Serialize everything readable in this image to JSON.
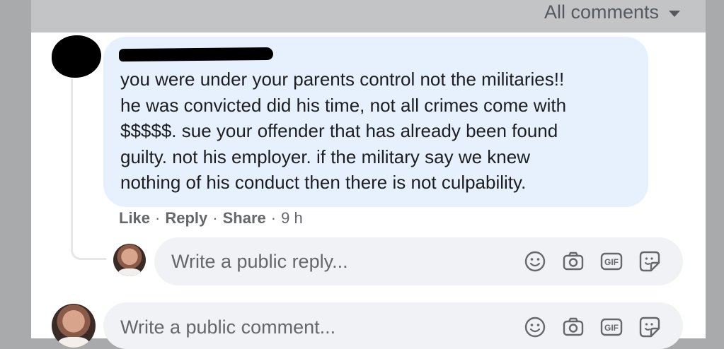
{
  "header": {
    "filter_label": "All comments"
  },
  "comment": {
    "text_lines": [
      "you were under your parents control not the militaries!!",
      "he was convicted did his time, not all crimes come with",
      "$$$$$. sue your offender that has already been found",
      "guilty. not his employer. if the military say we knew",
      "nothing of his conduct then there is not culpability."
    ],
    "actions": {
      "like": "Like",
      "reply": "Reply",
      "share": "Share",
      "separator": "·",
      "time": "9 h"
    }
  },
  "reply_box": {
    "placeholder": "Write a public reply..."
  },
  "comment_box": {
    "placeholder": "Write a public comment..."
  },
  "icons": [
    "emoji-icon",
    "camera-icon",
    "gif-icon",
    "sticker-icon"
  ],
  "colors": {
    "bubble": "#e7f1fd",
    "input": "#f0f2f5",
    "meta": "#65676b"
  }
}
